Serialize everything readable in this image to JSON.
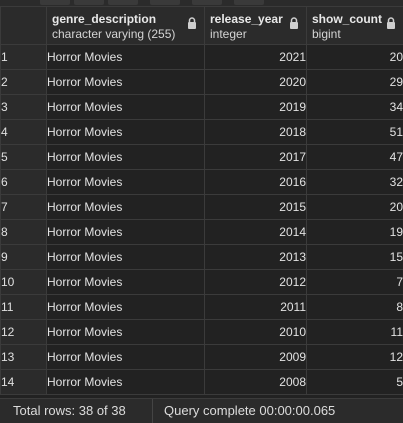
{
  "columns": [
    {
      "name": "genre_description",
      "type": "character varying (255)"
    },
    {
      "name": "release_year",
      "type": "integer"
    },
    {
      "name": "show_count",
      "type": "bigint"
    }
  ],
  "rows": [
    {
      "n": "1",
      "genre": "Horror Movies",
      "year": "2021",
      "count": "20"
    },
    {
      "n": "2",
      "genre": "Horror Movies",
      "year": "2020",
      "count": "29"
    },
    {
      "n": "3",
      "genre": "Horror Movies",
      "year": "2019",
      "count": "34"
    },
    {
      "n": "4",
      "genre": "Horror Movies",
      "year": "2018",
      "count": "51"
    },
    {
      "n": "5",
      "genre": "Horror Movies",
      "year": "2017",
      "count": "47"
    },
    {
      "n": "6",
      "genre": "Horror Movies",
      "year": "2016",
      "count": "32"
    },
    {
      "n": "7",
      "genre": "Horror Movies",
      "year": "2015",
      "count": "20"
    },
    {
      "n": "8",
      "genre": "Horror Movies",
      "year": "2014",
      "count": "19"
    },
    {
      "n": "9",
      "genre": "Horror Movies",
      "year": "2013",
      "count": "15"
    },
    {
      "n": "10",
      "genre": "Horror Movies",
      "year": "2012",
      "count": "7"
    },
    {
      "n": "11",
      "genre": "Horror Movies",
      "year": "2011",
      "count": "8"
    },
    {
      "n": "12",
      "genre": "Horror Movies",
      "year": "2010",
      "count": "11"
    },
    {
      "n": "13",
      "genre": "Horror Movies",
      "year": "2009",
      "count": "12"
    },
    {
      "n": "14",
      "genre": "Horror Movies",
      "year": "2008",
      "count": "5"
    }
  ],
  "status": {
    "total_rows": "Total rows: 38 of 38",
    "query": "Query complete 00:00:00.065"
  },
  "icons": {
    "column_lock": "lock-icon"
  },
  "colors": {
    "background": "#222222",
    "header": "#2b2b2b",
    "border": "#3b3b3b"
  }
}
